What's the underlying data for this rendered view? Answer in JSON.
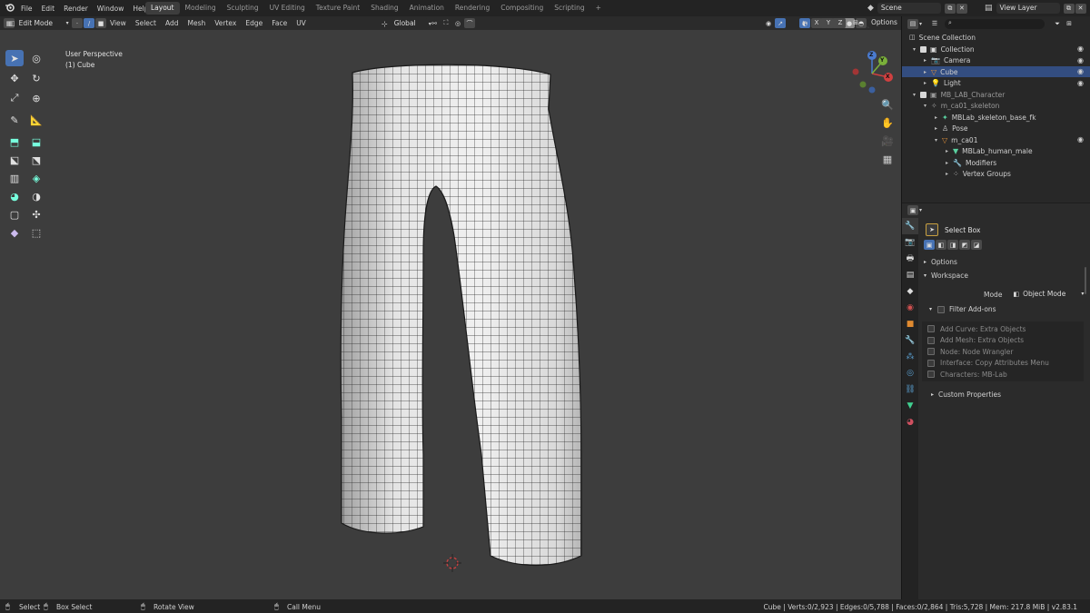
{
  "topbar": {
    "menus": [
      "File",
      "Edit",
      "Render",
      "Window",
      "Help"
    ],
    "workspaces": [
      {
        "label": "Layout",
        "active": true
      },
      {
        "label": "Modeling",
        "active": false
      },
      {
        "label": "Sculpting",
        "active": false
      },
      {
        "label": "UV Editing",
        "active": false
      },
      {
        "label": "Texture Paint",
        "active": false
      },
      {
        "label": "Shading",
        "active": false
      },
      {
        "label": "Animation",
        "active": false
      },
      {
        "label": "Rendering",
        "active": false
      },
      {
        "label": "Compositing",
        "active": false
      },
      {
        "label": "Scripting",
        "active": false
      }
    ],
    "add_workspace": "+",
    "scene": "Scene",
    "view_layer": "View Layer"
  },
  "viewport_header": {
    "mode": "Edit Mode",
    "menus": [
      "View",
      "Select",
      "Add",
      "Mesh",
      "Vertex",
      "Edge",
      "Face",
      "UV"
    ],
    "orientation": "Global",
    "options": "Options",
    "axes": [
      "X",
      "Y",
      "Z"
    ]
  },
  "viewport": {
    "perspective": "User Perspective",
    "object_label": "(1) Cube",
    "gizmo": {
      "x": "X",
      "y": "Y",
      "z": "Z"
    }
  },
  "outliner": {
    "root": "Scene Collection",
    "rows": [
      {
        "label": "Collection",
        "indent": 1
      },
      {
        "label": "Camera",
        "indent": 2
      },
      {
        "label": "Cube",
        "indent": 2,
        "selected": true
      },
      {
        "label": "Light",
        "indent": 2
      },
      {
        "label": "MB_LAB_Character",
        "indent": 1,
        "dim": true
      },
      {
        "label": "m_ca01_skeleton",
        "indent": 2,
        "dim": true
      },
      {
        "label": "MBLab_skeleton_base_fk",
        "indent": 3
      },
      {
        "label": "Pose",
        "indent": 3
      },
      {
        "label": "m_ca01",
        "indent": 3
      },
      {
        "label": "MBLab_human_male",
        "indent": 4
      },
      {
        "label": "Modifiers",
        "indent": 4
      },
      {
        "label": "Vertex Groups",
        "indent": 4
      }
    ]
  },
  "properties": {
    "tool_name": "Select Box",
    "options_label": "Options",
    "workspace_label": "Workspace",
    "mode_label": "Mode",
    "mode_value": "Object Mode",
    "filter_label": "Filter Add-ons",
    "addons": [
      "Add Curve: Extra Objects",
      "Add Mesh: Extra Objects",
      "Node: Node Wrangler",
      "Interface: Copy Attributes Menu",
      "Characters: MB-Lab"
    ],
    "custom_props": "Custom Properties"
  },
  "status": {
    "select": "Select",
    "box_select": "Box Select",
    "rotate_view": "Rotate View",
    "call_menu": "Call Menu",
    "stats": "Cube | Verts:0/2,923 | Edges:0/5,788 | Faces:0/2,864 | Tris:5,728 | Mem: 217.8 MiB | v2.83.1"
  }
}
